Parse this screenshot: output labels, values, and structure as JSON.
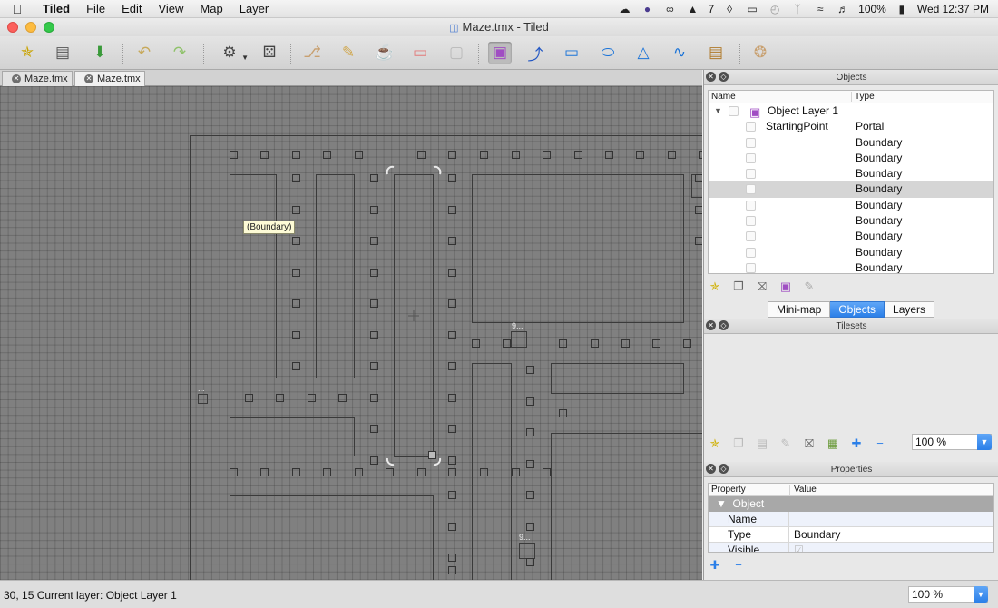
{
  "menubar": {
    "app": "Tiled",
    "items": [
      "File",
      "Edit",
      "View",
      "Map",
      "Layer"
    ],
    "status_icons": [
      "cloud-icon",
      "globe-icon",
      "creative-cloud-icon",
      "adobe-icon",
      "dropbox-icon",
      "airplay-icon",
      "time-machine-icon",
      "bluetooth-icon",
      "wifi-icon",
      "volume-icon"
    ],
    "adobe_count": "7",
    "battery": "100%",
    "clock": "Wed 12:37 PM"
  },
  "window": {
    "title": "Maze.tmx - Tiled"
  },
  "tabs": [
    {
      "label": "Maze.tmx",
      "selected": false
    },
    {
      "label": "Maze.tmx",
      "selected": true
    }
  ],
  "canvas": {
    "tooltip": "(Boundary)",
    "labels": [
      "9...",
      "9...",
      "..."
    ]
  },
  "objects_panel": {
    "title": "Objects",
    "col_name": "Name",
    "col_type": "Type",
    "layer_name": "Object Layer 1",
    "rows": [
      {
        "name": "StartingPoint",
        "type": "Portal"
      },
      {
        "name": "",
        "type": "Boundary"
      },
      {
        "name": "",
        "type": "Boundary"
      },
      {
        "name": "",
        "type": "Boundary"
      },
      {
        "name": "",
        "type": "Boundary",
        "selected": true
      },
      {
        "name": "",
        "type": "Boundary"
      },
      {
        "name": "",
        "type": "Boundary"
      },
      {
        "name": "",
        "type": "Boundary"
      },
      {
        "name": "",
        "type": "Boundary"
      },
      {
        "name": "",
        "type": "Boundary"
      }
    ]
  },
  "dock_tabs": [
    {
      "label": "Mini-map",
      "active": false
    },
    {
      "label": "Objects",
      "active": true
    },
    {
      "label": "Layers",
      "active": false
    }
  ],
  "tilesets_panel": {
    "title": "Tilesets",
    "zoom": "100 %"
  },
  "properties_panel": {
    "title": "Properties",
    "col_property": "Property",
    "col_value": "Value",
    "group": "Object",
    "rows": [
      {
        "key": "Name",
        "value": ""
      },
      {
        "key": "Type",
        "value": "Boundary"
      },
      {
        "key": "Visible",
        "value": ""
      }
    ]
  },
  "statusbar": {
    "text": "30, 15  Current layer: Object Layer 1",
    "zoom": "100 %"
  }
}
